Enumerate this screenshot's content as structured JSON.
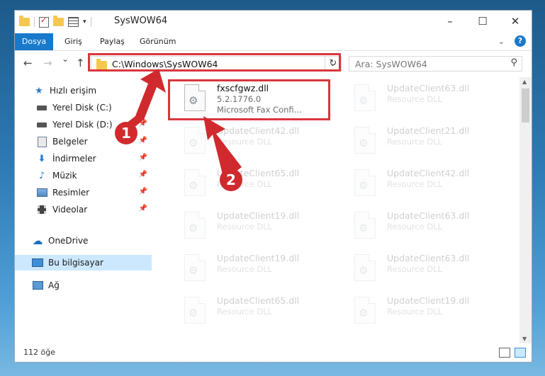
{
  "window": {
    "title": "SysWOW64",
    "controls": {
      "minimize": "–",
      "maximize": "☐",
      "close": "✕"
    }
  },
  "ribbon": {
    "tabs": [
      "Dosya",
      "Giriş",
      "Paylaş",
      "Görünüm"
    ],
    "help": "?"
  },
  "navigation": {
    "back": "←",
    "forward": "→",
    "recent": "⌄",
    "up": "↑",
    "address": "C:\\Windows\\SysWOW64",
    "search_placeholder": "Ara: SysWOW64"
  },
  "sidebar": {
    "items": [
      {
        "label": "Hızlı erişim",
        "icon": "star-icon",
        "pinned": false
      },
      {
        "label": "Yerel Disk (C:)",
        "icon": "drive-icon",
        "pinned": true
      },
      {
        "label": "Yerel Disk (D:)",
        "icon": "drive-icon",
        "pinned": true
      },
      {
        "label": "Belgeler",
        "icon": "documents-icon",
        "pinned": true
      },
      {
        "label": "İndirmeler",
        "icon": "download-icon",
        "pinned": true
      },
      {
        "label": "Müzik",
        "icon": "music-icon",
        "pinned": true
      },
      {
        "label": "Resimler",
        "icon": "pictures-icon",
        "pinned": true
      },
      {
        "label": "Videolar",
        "icon": "videos-icon",
        "pinned": true
      },
      {
        "label": "OneDrive",
        "icon": "cloud-icon",
        "pinned": false
      },
      {
        "label": "Bu bilgisayar",
        "icon": "computer-icon",
        "pinned": false,
        "selected": true
      },
      {
        "label": "Ağ",
        "icon": "network-icon",
        "pinned": false
      }
    ]
  },
  "files": [
    {
      "name": "fxscfgwz.dll",
      "version": "5.2.1776.0",
      "description": "Microsoft Fax Confi...",
      "highlighted": true
    },
    {
      "name": "UpdateClient63.dll",
      "description": "Resource DLL"
    },
    {
      "name": "UpdateClient42.dll",
      "description": "Resource DLL"
    },
    {
      "name": "UpdateClient21.dll",
      "description": "Resource DLL"
    },
    {
      "name": "UpdateClient65.dll",
      "description": "Resource DLL"
    },
    {
      "name": "UpdateClient42.dll",
      "description": "Resource DLL"
    },
    {
      "name": "UpdateClient19.dll",
      "description": "Resource DLL"
    },
    {
      "name": "UpdateClient63.dll",
      "description": "Resource DLL"
    },
    {
      "name": "UpdateClient19.dll",
      "description": "Resource DLL"
    },
    {
      "name": "UpdateClient63.dll",
      "description": "Resource DLL"
    },
    {
      "name": "UpdateClient65.dll",
      "description": "Resource DLL"
    },
    {
      "name": "UpdateClient19.dll",
      "description": "Resource DLL"
    }
  ],
  "status": {
    "item_count": "112 öğe"
  },
  "callouts": [
    "1",
    "2"
  ],
  "colors": {
    "accent": "#1979ca",
    "annotation": "#d9363e",
    "selection": "#cce8ff"
  }
}
